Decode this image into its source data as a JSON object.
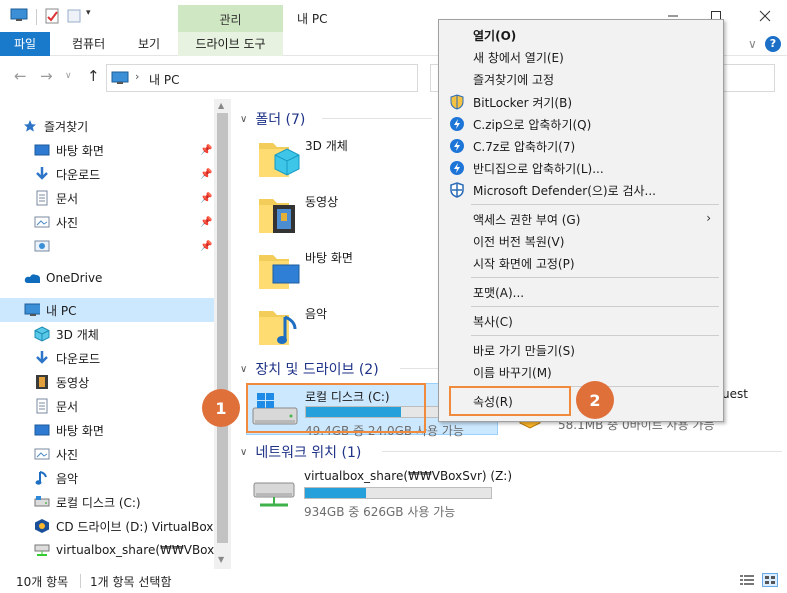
{
  "window": {
    "title": "내 PC",
    "context_tab_group": "관리"
  },
  "ribbon": {
    "file": "파일",
    "computer": "컴퓨터",
    "view": "보기",
    "drive_tools": "드라이브 도구"
  },
  "address": {
    "path": "내 PC"
  },
  "nav": {
    "quick_access": "즐겨찾기",
    "qa_items": [
      "바탕 화면",
      "다운로드",
      "문서",
      "사진"
    ],
    "onedrive": "OneDrive",
    "this_pc": "내 PC",
    "pc_items": [
      "3D 개체",
      "다운로드",
      "동영상",
      "문서",
      "바탕 화면",
      "사진",
      "음악",
      "로컬 디스크 (C:)",
      "CD 드라이브 (D:) VirtualBox G",
      "virtualbox_share(₩₩VBoxSvr)"
    ]
  },
  "content": {
    "folders_header": "폴더 (7)",
    "folders": [
      "3D 개체",
      "동영상",
      "바탕 화면",
      "음악"
    ],
    "devices_header": "장치 및 드라이브 (2)",
    "drive_c": {
      "name": "로컬 디스크 (C:)",
      "info": "49.4GB 중 24.0GB 사용 가능",
      "used_fraction": 0.51
    },
    "drive_d": {
      "name_partial": "uest",
      "info": "58.1MB 중 0바이트 사용 가능"
    },
    "network_header": "네트워크 위치 (1)",
    "network_drive": {
      "name": "virtualbox_share(₩₩VBoxSvr) (Z:)",
      "info": "934GB 중 626GB 사용 가능",
      "used_fraction": 0.33
    }
  },
  "status": {
    "items": "10개 항목",
    "selected": "1개 항목 선택함"
  },
  "context_menu": {
    "open": "열기(O)",
    "open_new_window": "새 창에서 열기(E)",
    "pin_quick_access": "즐겨찾기에 고정",
    "bitlocker": "BitLocker 켜기(B)",
    "zip": "C.zip으로 압축하기(Q)",
    "7z": "C.7z로 압축하기(7)",
    "bandizip": "반디집으로 압축하기(L)...",
    "defender": "Microsoft Defender(으)로 검사...",
    "give_access": "액세스 권한 부여 (G)",
    "restore_versions": "이전 버전 복원(V)",
    "pin_start": "시작 화면에 고정(P)",
    "format": "포맷(A)...",
    "copy": "복사(C)",
    "create_shortcut": "바로 가기 만들기(S)",
    "rename": "이름 바꾸기(M)",
    "properties": "속성(R)"
  },
  "annotations": {
    "badge1": "1",
    "badge2": "2",
    "color": "#e0703a"
  }
}
